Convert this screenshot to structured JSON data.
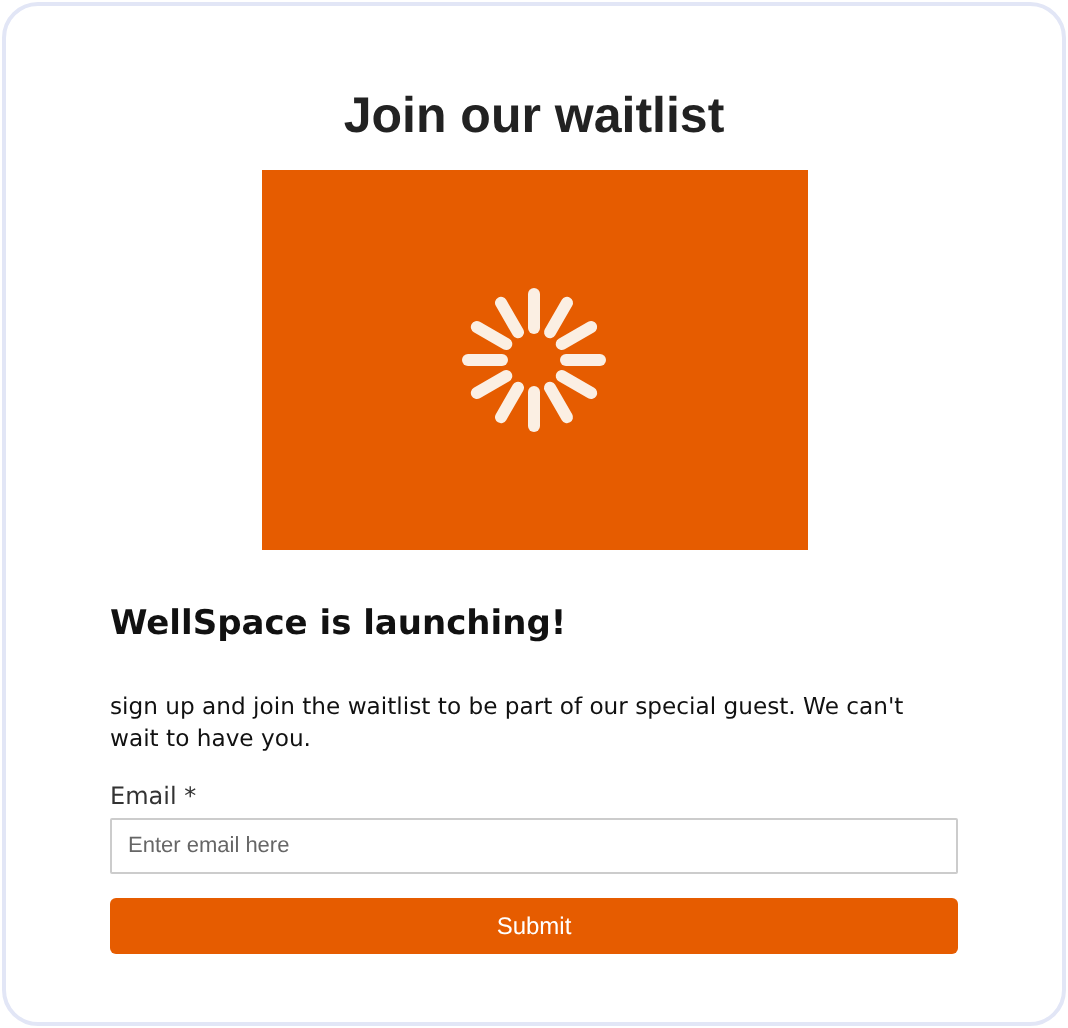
{
  "title": "Join our waitlist",
  "banner": {
    "loading": true
  },
  "heading": "WellSpace is launching!",
  "description": "sign up and join the waitlist to be part of our special guest. We can't wait to have you.",
  "email_field": {
    "label": "Email *",
    "placeholder": "Enter email here"
  },
  "submit_button": "Submit"
}
